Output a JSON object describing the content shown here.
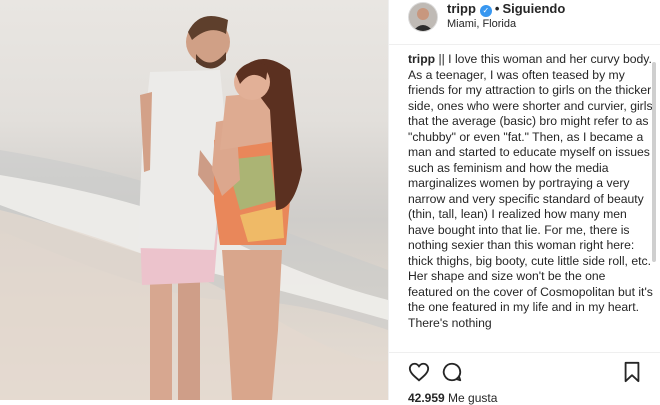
{
  "post": {
    "username": "tripp",
    "verified_icon": "verified-badge-icon",
    "separator": "•",
    "follow_status": "Siguiendo",
    "location": "Miami, Florida",
    "caption_user": "tripp",
    "caption_text": " || I love this woman and her curvy body. As a teenager, I was often teased by my friends for my attraction to girls on the thicker side, ones who were shorter and curvier, girls that the average (basic) bro might refer to as \"chubby\" or even \"fat.\" Then, as I became a man and started to educate myself on issues such as feminism and how the media marginalizes women by portraying a very narrow and very specific standard of beauty (thin, tall, lean) I realized how many men have bought into that lie. For me, there is nothing sexier than this woman right here: thick thighs, big booty, cute little side roll, etc. Her shape and size won't be the one featured on the cover of Cosmopolitan but it's the one featured in my life and in my heart. There's nothing",
    "likes_count": "42.959",
    "likes_label": "Me gusta"
  },
  "icons": {
    "like": "heart-icon",
    "comment": "comment-icon",
    "save": "bookmark-icon"
  },
  "colors": {
    "verified": "#3897f0",
    "text": "#262626",
    "divider": "#efefef"
  }
}
